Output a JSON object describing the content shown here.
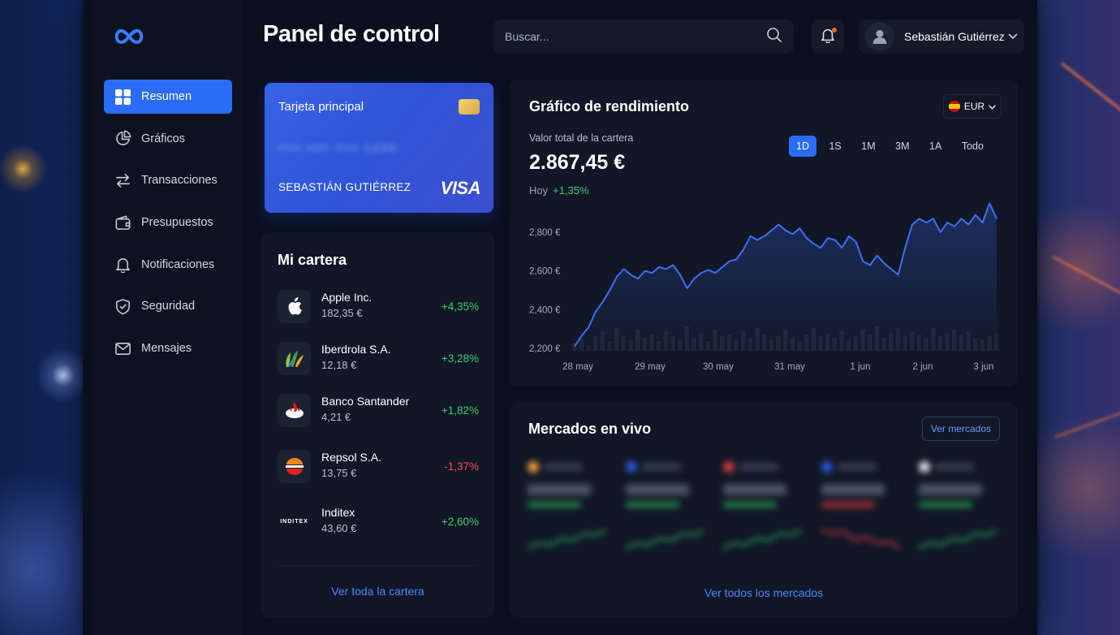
{
  "header": {
    "title": "Panel de control",
    "search_placeholder": "Buscar...",
    "user_name": "Sebastián Gutiérrez"
  },
  "sidebar": {
    "items": [
      {
        "label": "Resumen",
        "icon": "grid-icon",
        "active": true
      },
      {
        "label": "Gráficos",
        "icon": "pie-chart-icon"
      },
      {
        "label": "Transacciones",
        "icon": "transfer-arrows-icon"
      },
      {
        "label": "Presupuestos",
        "icon": "wallet-icon"
      },
      {
        "label": "Notificaciones",
        "icon": "bell-icon"
      },
      {
        "label": "Seguridad",
        "icon": "shield-icon"
      },
      {
        "label": "Mensajes",
        "icon": "mail-icon"
      }
    ]
  },
  "card": {
    "title": "Tarjeta principal",
    "number_masked": "•••• •••• •••• 1234",
    "holder": "SEBASTIÁN GUTIÉRREZ",
    "brand": "VISA"
  },
  "wallet": {
    "title": "Mi cartera",
    "assets": [
      {
        "name": "Apple Inc.",
        "price": "182,35 €",
        "change": "+4,35%",
        "direction": "up"
      },
      {
        "name": "Iberdrola S.A.",
        "price": "12,18 €",
        "change": "+3,28%",
        "direction": "up"
      },
      {
        "name": "Banco Santander",
        "price": "4,21 €",
        "change": "+1,82%",
        "direction": "up"
      },
      {
        "name": "Repsol S.A.",
        "price": "13,75 €",
        "change": "-1,37%",
        "direction": "down"
      },
      {
        "name": "Inditex",
        "logo_text": "INDITEX",
        "price": "43,60 €",
        "change": "+2,60%",
        "direction": "up"
      }
    ],
    "link": "Ver toda la cartera"
  },
  "performance": {
    "title": "Gráfico de rendimiento",
    "currency": "EUR",
    "subtitle": "Valor total de la cartera",
    "value": "2.867,45 €",
    "today_label": "Hoy",
    "today_change": "+1,35%",
    "ranges": [
      "1D",
      "1S",
      "1M",
      "3M",
      "1A",
      "Todo"
    ],
    "active_range": "1D"
  },
  "chart_data": {
    "type": "line",
    "y_tick_labels": [
      "2,800 €",
      "2,600 €",
      "2,400 €",
      "2,200 €"
    ],
    "x_tick_labels": [
      "28 may",
      "29 may",
      "30 may",
      "31 may",
      "1 jun",
      "2 jun",
      "3 jun"
    ],
    "ylim": [
      2200,
      2860
    ],
    "series": [
      {
        "values": [
          2210,
          2265,
          2310,
          2390,
          2440,
          2500,
          2570,
          2610,
          2580,
          2560,
          2600,
          2590,
          2620,
          2610,
          2630,
          2580,
          2510,
          2560,
          2590,
          2605,
          2590,
          2620,
          2650,
          2660,
          2710,
          2780,
          2760,
          2780,
          2810,
          2840,
          2810,
          2790,
          2820,
          2770,
          2740,
          2720,
          2770,
          2760,
          2720,
          2780,
          2750,
          2650,
          2630,
          2680,
          2640,
          2610,
          2580,
          2720,
          2840,
          2870,
          2850,
          2870,
          2800,
          2850,
          2830,
          2870,
          2840,
          2890,
          2850,
          2950,
          2870
        ]
      }
    ],
    "volume": [
      5,
      8,
      3,
      9,
      12,
      6,
      14,
      9,
      7,
      13,
      8,
      10,
      6,
      12,
      9,
      7,
      15,
      8,
      11,
      6,
      13,
      9,
      10,
      7,
      12,
      8,
      14,
      10,
      7,
      9,
      13,
      8,
      6,
      10,
      14,
      9,
      11,
      8,
      12,
      7,
      9,
      13,
      10,
      15,
      8,
      11,
      14,
      9,
      12,
      10,
      8,
      14,
      9,
      11,
      13,
      10,
      12,
      8,
      7,
      9,
      11
    ],
    "color": "#3f6ff5",
    "grid": false
  },
  "markets": {
    "title": "Mercados en vivo",
    "button": "Ver mercados",
    "link": "Ver todos los mercados",
    "tickers": [
      {
        "color": "#e8a13a",
        "direction": "up"
      },
      {
        "color": "#2b5ad8",
        "direction": "up"
      },
      {
        "color": "#d43a3a",
        "direction": "up"
      },
      {
        "color": "#2b5ad8",
        "direction": "down"
      },
      {
        "color": "#dadde4",
        "direction": "up"
      }
    ]
  }
}
